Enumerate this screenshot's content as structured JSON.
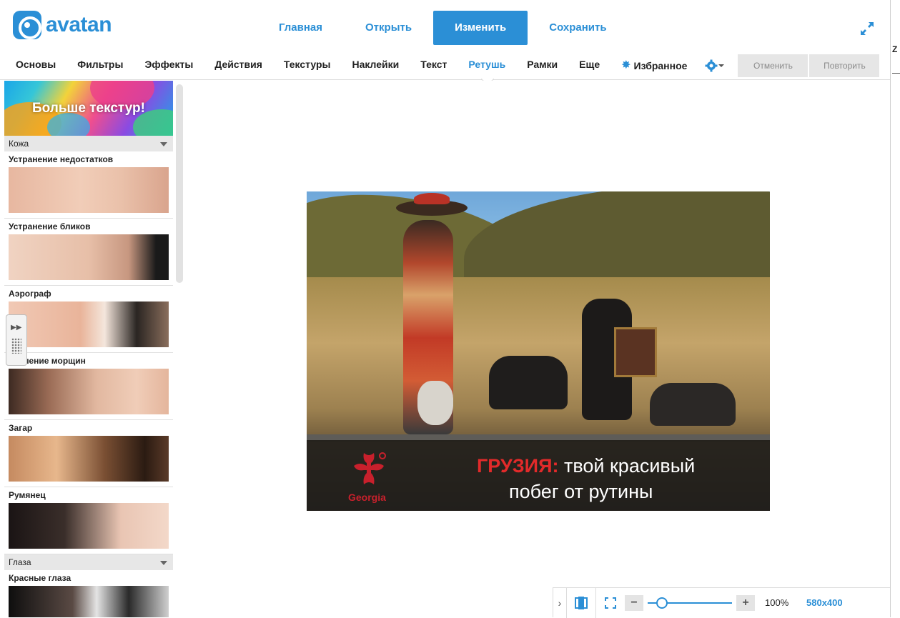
{
  "brand": {
    "name": "avatan",
    "color": "#2b8fd6"
  },
  "main_nav": [
    {
      "label": "Главная",
      "active": false
    },
    {
      "label": "Открыть",
      "active": false
    },
    {
      "label": "Изменить",
      "active": true
    },
    {
      "label": "Сохранить",
      "active": false
    }
  ],
  "tools_nav": [
    {
      "label": "Основы"
    },
    {
      "label": "Фильтры"
    },
    {
      "label": "Эффекты"
    },
    {
      "label": "Действия"
    },
    {
      "label": "Текстуры"
    },
    {
      "label": "Наклейки"
    },
    {
      "label": "Текст"
    },
    {
      "label": "Ретушь",
      "active": true
    },
    {
      "label": "Рамки"
    },
    {
      "label": "Еще"
    }
  ],
  "favorites_label": "Избранное",
  "undo_label": "Отменить",
  "redo_label": "Повторить",
  "sidebar": {
    "promo_text": "Больше текстур!",
    "section_skin": "Кожа",
    "skin_tools": [
      "Устранение недостатков",
      "Устранение бликов",
      "Аэрограф",
      "Удаление морщин",
      "Загар",
      "Румянец"
    ],
    "section_eyes": "Глаза",
    "eye_tools": [
      "Красные глаза"
    ]
  },
  "photo": {
    "tagline_highlight": "ГРУЗИЯ:",
    "tagline_rest": " твой красивый",
    "tagline_line2": "побег от рутины",
    "logo_text": "Georgia"
  },
  "bottom_bar": {
    "zoom": "100%",
    "dimensions": "580x400"
  },
  "right_strip_glyph": "Z"
}
